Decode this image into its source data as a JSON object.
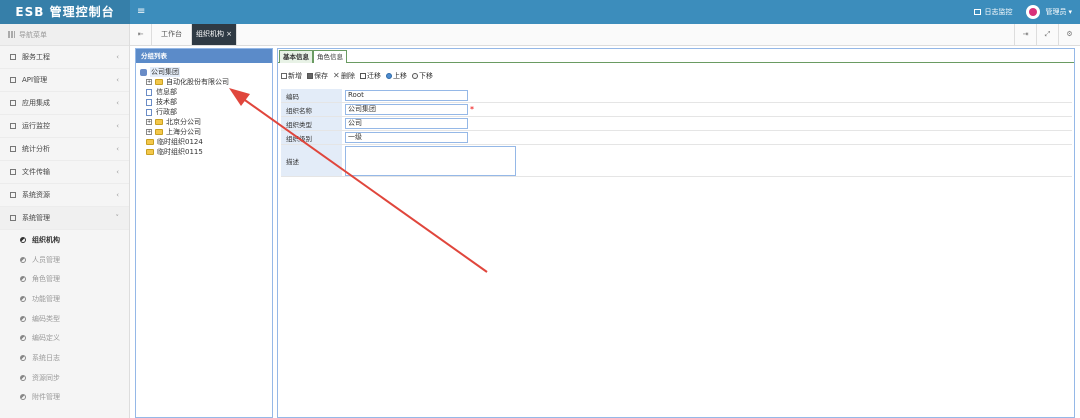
{
  "header": {
    "brand": "ESB 管理控制台",
    "menu_icon": "hamburger-icon",
    "log_monitor": "日志监控",
    "user": "管理员",
    "user_caret": "▾"
  },
  "sidebar": {
    "nav_title": "导航菜单",
    "chevron_right": "‹",
    "chevron_down": "˅",
    "items": [
      {
        "label": "服务工程"
      },
      {
        "label": "API管理"
      },
      {
        "label": "应用集成"
      },
      {
        "label": "运行监控"
      },
      {
        "label": "统计分析"
      },
      {
        "label": "文件传输"
      },
      {
        "label": "系统资源"
      },
      {
        "label": "系统管理"
      }
    ],
    "subitems": [
      {
        "label": "组织机构"
      },
      {
        "label": "人员管理"
      },
      {
        "label": "角色管理"
      },
      {
        "label": "功能管理"
      },
      {
        "label": "编码类型"
      },
      {
        "label": "编码定义"
      },
      {
        "label": "系统日志"
      },
      {
        "label": "资源同步"
      },
      {
        "label": "附件管理"
      }
    ]
  },
  "tabs": {
    "back": "⇤",
    "forward": "⇥",
    "fullscreen": "⤢",
    "settings": "⚙",
    "items": [
      {
        "label": "工作台"
      },
      {
        "label": "组织机构 ×"
      }
    ]
  },
  "left_panel": {
    "title": "分组列表",
    "tree": {
      "root": "公司集团",
      "company": "自动化股份有限公司",
      "dept1": "信息部",
      "dept2": "技术部",
      "dept3": "行政部",
      "branch1": "北京分公司",
      "branch2": "上海分公司",
      "temp1": "临时组织0124",
      "temp2": "临时组织0115"
    }
  },
  "right_panel": {
    "tabs": [
      {
        "label": "基本信息"
      },
      {
        "label": "角色信息"
      }
    ],
    "toolbar": {
      "add": "新增",
      "save": "保存",
      "delete": "删除",
      "migrate": "迁移",
      "up": "上移",
      "down": "下移"
    },
    "form": {
      "code_label": "编码",
      "code_value": "Root",
      "name_label": "组织名称",
      "name_value": "公司集团",
      "required_mark": "*",
      "type_label": "组织类型",
      "type_value": "公司",
      "level_label": "组织级别",
      "level_value": "一级",
      "desc_label": "描述",
      "desc_value": ""
    }
  },
  "annotation": {
    "arrow_color": "#e0463c"
  }
}
